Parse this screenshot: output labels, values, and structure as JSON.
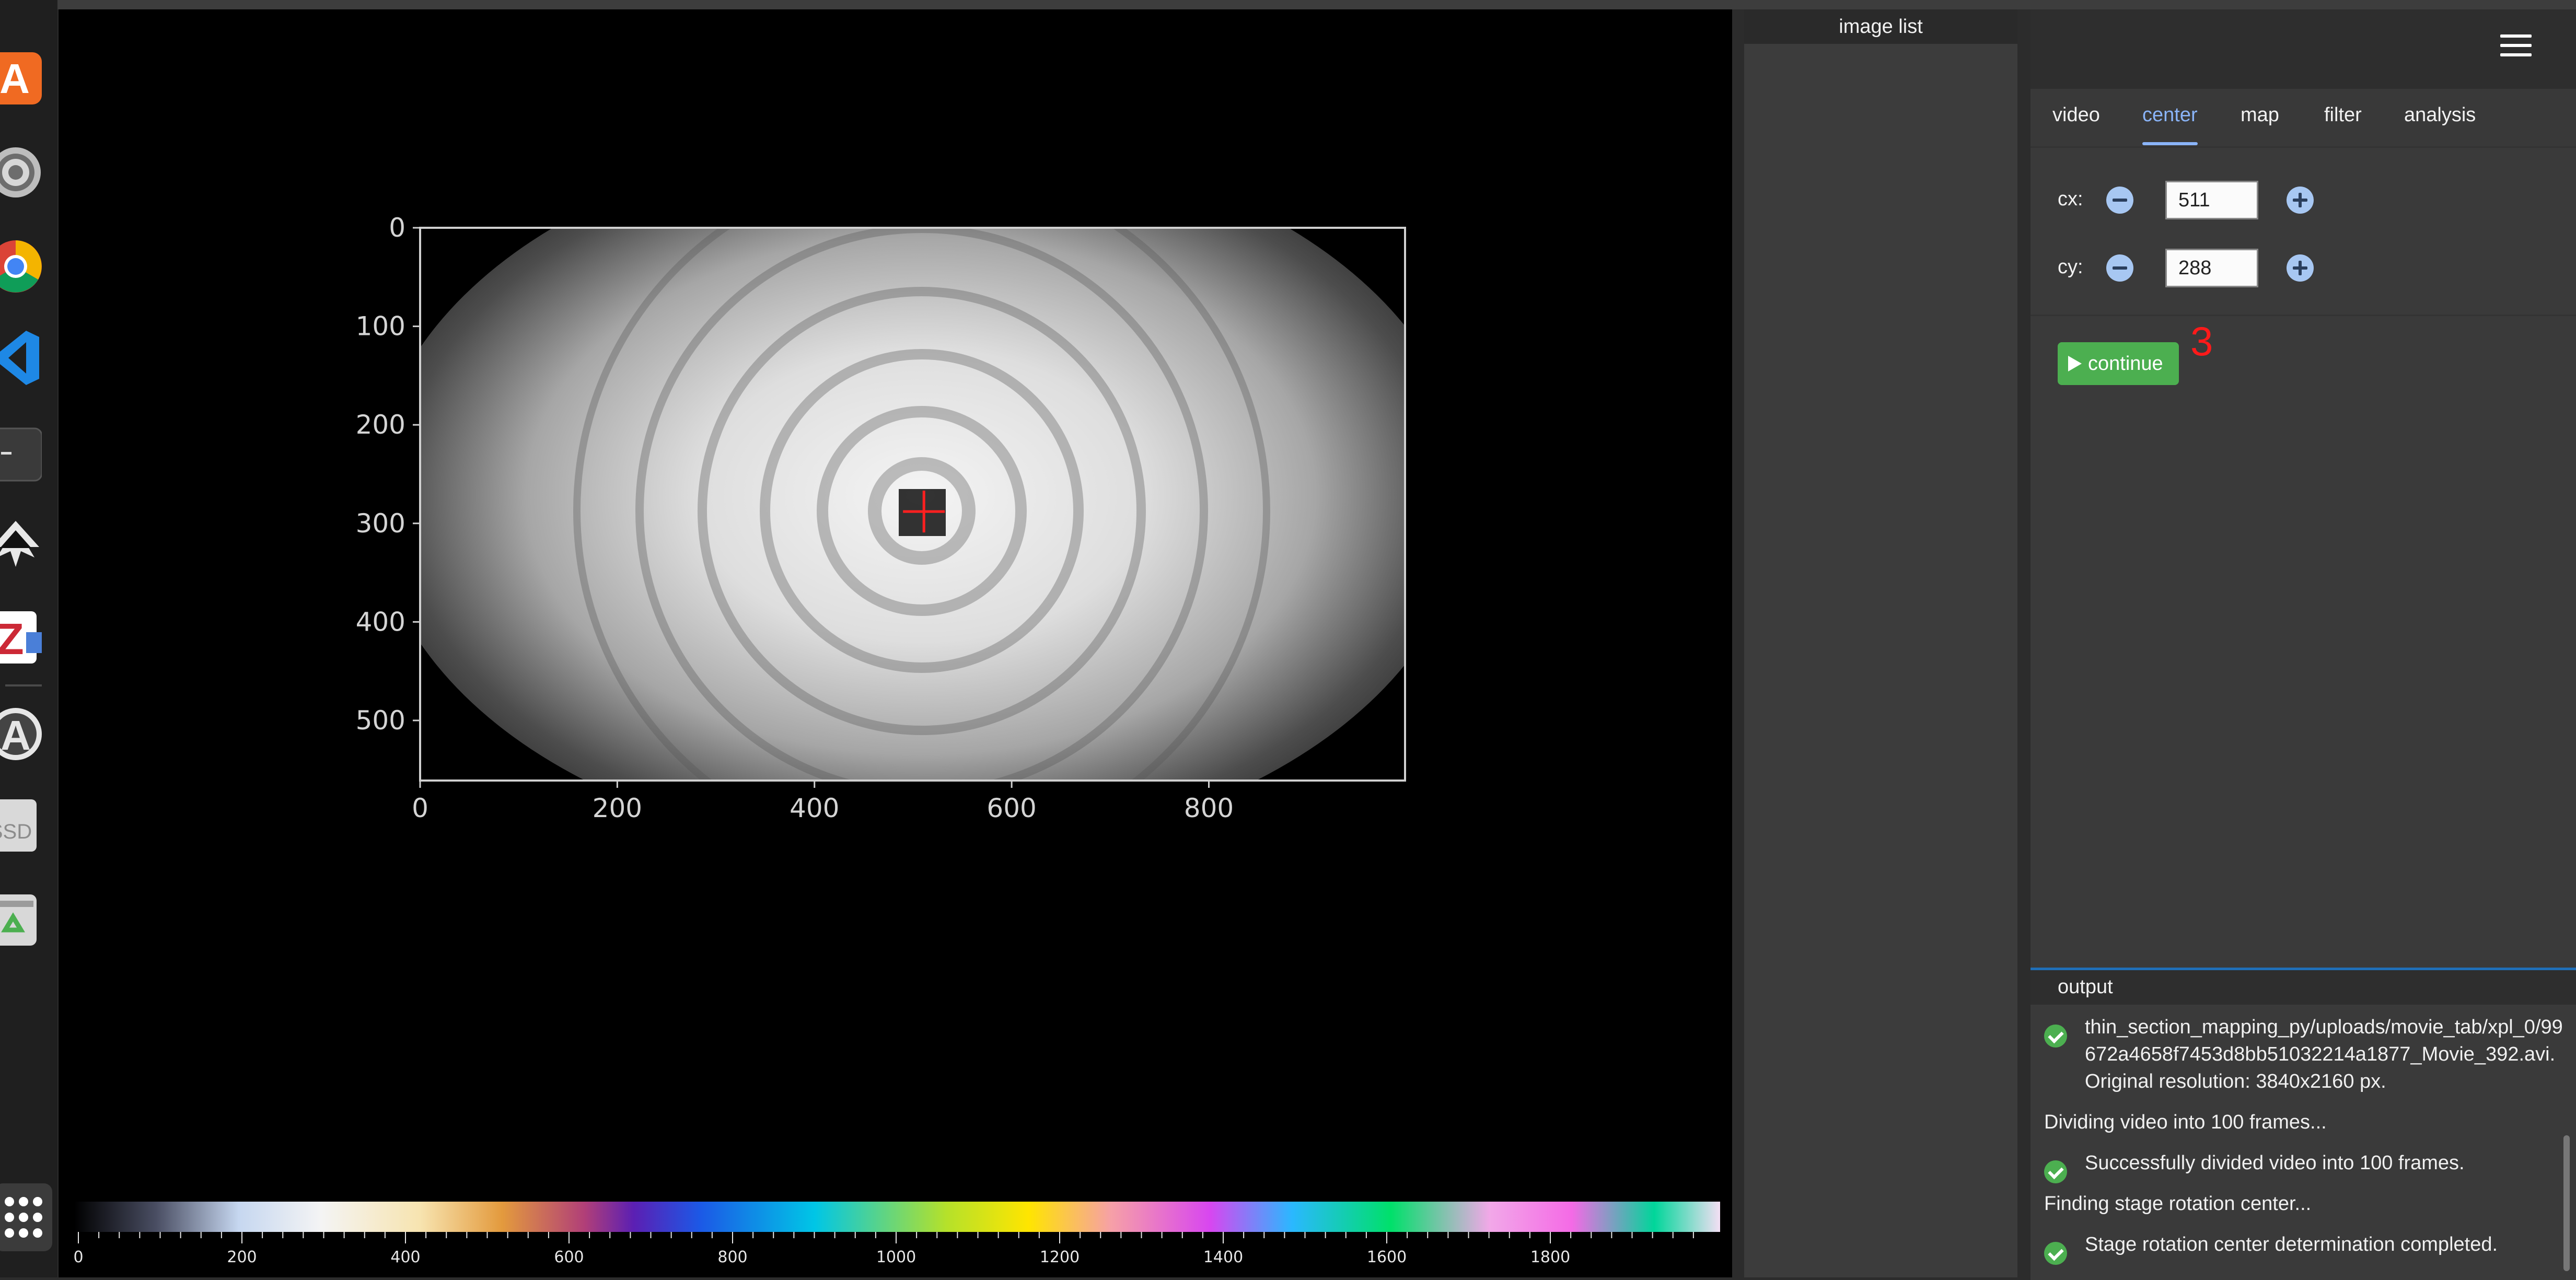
{
  "dock": {
    "items": [
      "app-store-icon",
      "settings-icon",
      "chrome-icon",
      "vscode-icon",
      "terminal-icon",
      "inkscape-icon",
      "zotero-icon",
      "software-updater-icon",
      "ssd-drive-icon",
      "trash-icon"
    ],
    "ssd_label": "SSD",
    "apps_grid_icon": "show-apps-icon"
  },
  "plot": {
    "x_ticks": [
      "0",
      "200",
      "400",
      "600",
      "800"
    ],
    "y_ticks": [
      "0",
      "100",
      "200",
      "300",
      "400",
      "500"
    ],
    "x_tick_values": [
      0,
      200,
      400,
      600,
      800
    ],
    "y_tick_values": [
      0,
      100,
      200,
      300,
      400,
      500
    ],
    "xlim": [
      0,
      999
    ],
    "ylim": [
      0,
      561
    ],
    "center_marker": {
      "x": 511,
      "y": 288,
      "color": "#ff2020"
    }
  },
  "colorbar": {
    "labels": [
      "0",
      "200",
      "400",
      "600",
      "800",
      "1000",
      "1200",
      "1400",
      "1600",
      "1800"
    ],
    "values": [
      0,
      200,
      400,
      600,
      800,
      1000,
      1200,
      1400,
      1600,
      1800
    ],
    "range": [
      0,
      2000
    ]
  },
  "image_list": {
    "title": "image list"
  },
  "right_panel": {
    "menu_icon": "hamburger-menu-icon",
    "tabs": [
      {
        "label": "video",
        "active": false
      },
      {
        "label": "center",
        "active": true
      },
      {
        "label": "map",
        "active": false
      },
      {
        "label": "filter",
        "active": false
      },
      {
        "label": "analysis",
        "active": false
      }
    ],
    "cx": {
      "label": "cx:",
      "value": "511"
    },
    "cy": {
      "label": "cy:",
      "value": "288"
    },
    "continue_label": "continue",
    "step_number": "3"
  },
  "output": {
    "title": "output",
    "lines": [
      {
        "text": "thin_section_mapping_py/uploads/movie_tab/xpl_0/99",
        "icon": "check-circle-icon"
      },
      {
        "text": "672a4658f7453d8bb51032214a1877_Movie_392.avi.",
        "icon": null
      },
      {
        "text": "Original resolution: 3840x2160 px.",
        "icon": null
      },
      {
        "text": "Dividing video into 100 frames...",
        "icon": null
      },
      {
        "text": "Successfully divided video into 100 frames.",
        "icon": "check-circle-icon"
      },
      {
        "text": "Finding stage rotation center...",
        "icon": null
      },
      {
        "text": "Stage rotation center determination completed.",
        "icon": "check-circle-icon"
      }
    ]
  }
}
